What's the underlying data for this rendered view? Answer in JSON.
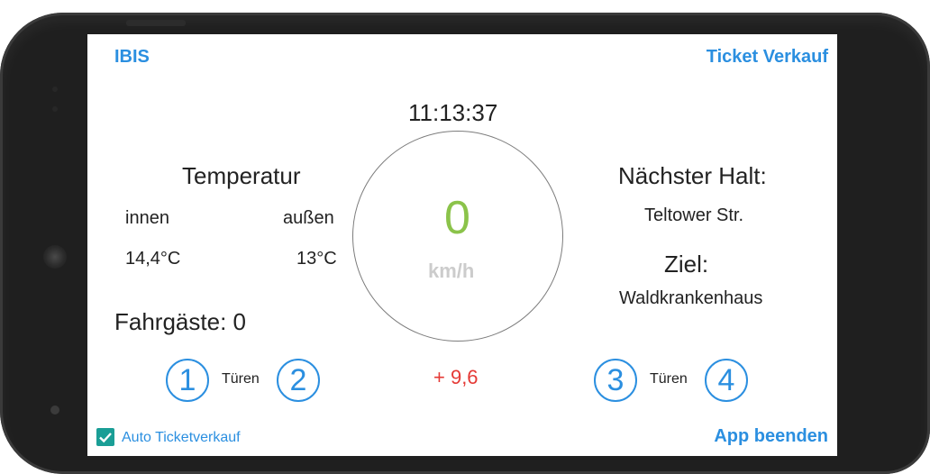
{
  "header": {
    "left_link": "IBIS",
    "right_link": "Ticket Verkauf"
  },
  "clock": "11:13:37",
  "temperature": {
    "title": "Temperatur",
    "inside_label": "innen",
    "outside_label": "außen",
    "inside_value": "14,4°C",
    "outside_value": "13°C"
  },
  "passengers": "Fahrgäste: 0",
  "speed": {
    "value": "0",
    "unit": "km/h",
    "delta": "+ 9,6"
  },
  "next_stop": {
    "label": "Nächster Halt:",
    "value": "Teltower Str."
  },
  "destination": {
    "label": "Ziel:",
    "value": "Waldkrankenhaus"
  },
  "doors": {
    "label": "Türen",
    "left": [
      "1",
      "2"
    ],
    "right": [
      "3",
      "4"
    ]
  },
  "footer": {
    "checkbox_label": "Auto Ticketverkauf",
    "checkbox_checked": true,
    "exit_link": "App beenden"
  },
  "colors": {
    "accent": "#2b8fe0",
    "speed": "#8bc34a",
    "delta": "#e53935",
    "checkbox": "#1a9e96"
  }
}
